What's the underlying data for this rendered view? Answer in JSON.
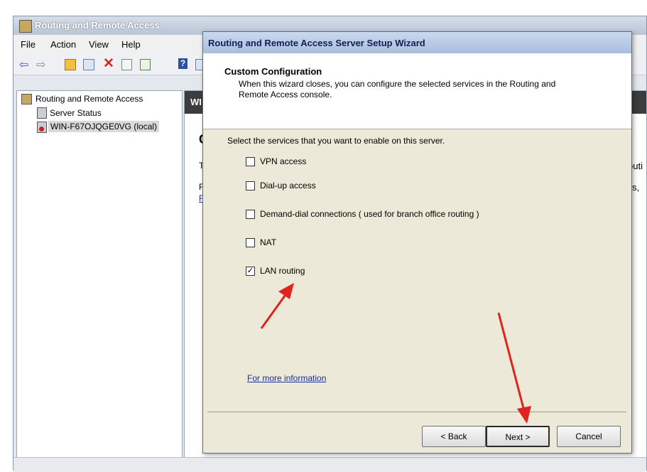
{
  "console": {
    "title": "Routing and Remote Access",
    "menu": [
      "File",
      "Action",
      "View",
      "Help"
    ],
    "tree": {
      "root": "Routing and Remote Access",
      "children": [
        "Server Status",
        "WIN-F67OJQGE0VG (local)"
      ]
    },
    "right_pane_header": "WI",
    "partial_text": [
      "C",
      "T",
      "F",
      "R",
      "outi",
      "los,"
    ]
  },
  "wizard": {
    "title": "Routing and Remote Access Server Setup Wizard",
    "header_title": "Custom Configuration",
    "header_desc": "When this wizard closes, you can configure the selected services in the Routing and Remote Access console.",
    "prompt": "Select the services that you want to enable on this server.",
    "options": [
      {
        "label": "VPN access",
        "checked": false
      },
      {
        "label": "Dial-up access",
        "checked": false
      },
      {
        "label": "Demand-dial connections ( used for branch office routing )",
        "checked": false
      },
      {
        "label": "NAT",
        "checked": false
      },
      {
        "label": "LAN routing",
        "checked": true
      }
    ],
    "more_info": "For more information",
    "buttons": {
      "back": "< Back",
      "next": "Next >",
      "cancel": "Cancel"
    }
  },
  "colors": {
    "annotation_arrow": "#e0231c"
  }
}
